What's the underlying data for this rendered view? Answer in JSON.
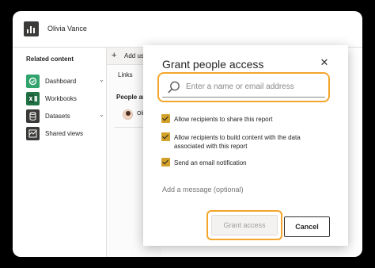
{
  "header": {
    "user_name": "Olivia Vance"
  },
  "sidebar": {
    "title": "Related content",
    "items": [
      {
        "label": "Dashboard",
        "icon": "dashboard-icon",
        "color": "#30a46c",
        "chevron": "⌄"
      },
      {
        "label": "Workbooks",
        "icon": "excel-icon",
        "color": "#217346"
      },
      {
        "label": "Datasets",
        "icon": "dataset-icon",
        "color": "#3b3a39",
        "chevron": "⌄"
      },
      {
        "label": "Shared views",
        "icon": "shared-views-icon",
        "color": "#3b3a39"
      }
    ]
  },
  "share_panel": {
    "add_users_label": "Add use",
    "links_tab": "Links",
    "people_title": "People ar",
    "people": [
      {
        "name": "Oliv"
      }
    ]
  },
  "dialog": {
    "title": "Grant people access",
    "close": "✕",
    "search_placeholder": "Enter a name or email address",
    "options": [
      {
        "label": "Allow recipients to share this report",
        "checked": true
      },
      {
        "label": "Allow recipients to build content with the data associated with this report",
        "checked": true
      },
      {
        "label": "Send an email notification",
        "checked": true
      }
    ],
    "message_placeholder": "Add a message (optional)",
    "grant_label": "Grant access",
    "cancel_label": "Cancel"
  },
  "colors": {
    "highlight": "#f4a52c",
    "checkbox": "#d2a12a"
  }
}
